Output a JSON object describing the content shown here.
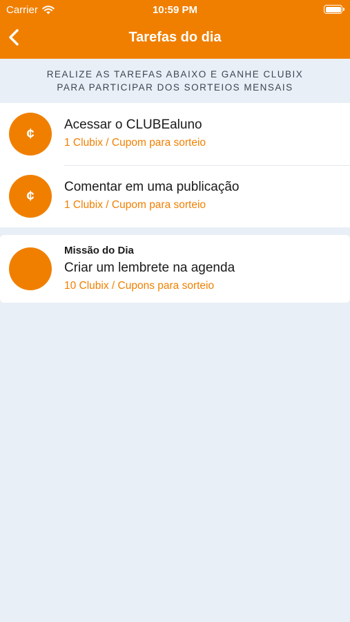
{
  "status_bar": {
    "carrier": "Carrier",
    "time": "10:59 PM"
  },
  "nav": {
    "title": "Tarefas do dia"
  },
  "instructions": {
    "line1": "REALIZE AS TAREFAS ABAIXO E GANHE CLUBIX",
    "line2": "PARA PARTICIPAR DOS SORTEIOS MENSAIS"
  },
  "tasks": [
    {
      "symbol": "¢",
      "title": "Acessar o CLUBEaluno",
      "reward": "1 Clubix / Cupom para sorteio"
    },
    {
      "symbol": "¢",
      "title": "Comentar em uma publicação",
      "reward": "1 Clubix / Cupom para sorteio"
    }
  ],
  "mission": {
    "label": "Missão do Dia",
    "title": "Criar um lembrete na agenda",
    "reward": "10 Clubix / Cupons para sorteio"
  },
  "colors": {
    "accent": "#f07f00",
    "background": "#e9eff6",
    "text": "#1a1a1a"
  }
}
